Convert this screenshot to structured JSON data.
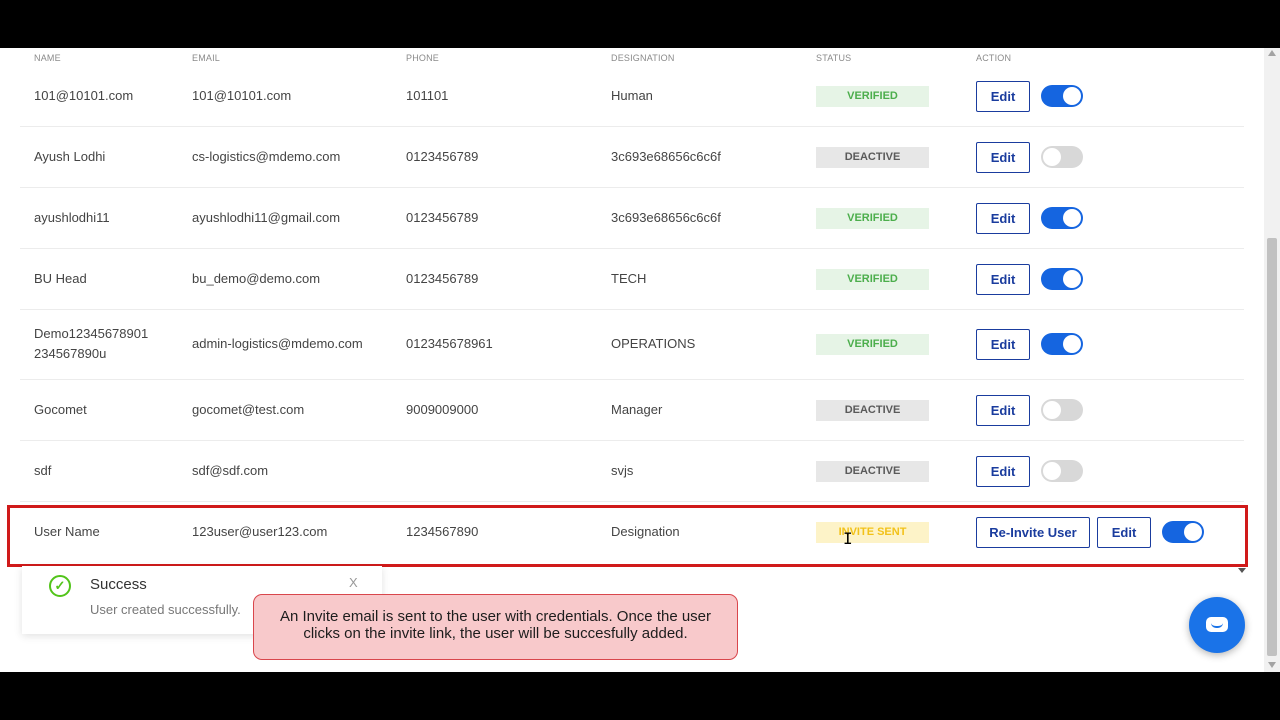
{
  "table": {
    "headers": {
      "name": "NAME",
      "email": "EMAIL",
      "phone": "PHONE",
      "designation": "DESIGNATION",
      "status": "STATUS",
      "action": "ACTION"
    },
    "rows": [
      {
        "name": "101@10101.com",
        "email": "101@10101.com",
        "phone": "101101",
        "designation": "Human",
        "status": "VERIFIED",
        "status_type": "verified",
        "edit": "Edit",
        "toggle": "on"
      },
      {
        "name": "Ayush Lodhi",
        "email": "cs-logistics@mdemo.com",
        "phone": "0123456789",
        "designation": "3c693e68656c6c6f",
        "status": "DEACTIVE",
        "status_type": "deactive",
        "edit": "Edit",
        "toggle": "off"
      },
      {
        "name": "ayushlodhi11",
        "email": "ayushlodhi11@gmail.com",
        "phone": "0123456789",
        "designation": "3c693e68656c6c6f",
        "status": "VERIFIED",
        "status_type": "verified",
        "edit": "Edit",
        "toggle": "on"
      },
      {
        "name": "BU Head",
        "email": "bu_demo@demo.com",
        "phone": "0123456789",
        "designation": "TECH",
        "status": "VERIFIED",
        "status_type": "verified",
        "edit": "Edit",
        "toggle": "on"
      },
      {
        "name": "Demo12345678901 234567890u",
        "email": "admin-logistics@mdemo.com",
        "phone": "012345678961",
        "designation": "OPERATIONS",
        "status": "VERIFIED",
        "status_type": "verified",
        "edit": "Edit",
        "toggle": "on"
      },
      {
        "name": "Gocomet",
        "email": "gocomet@test.com",
        "phone": "9009009000",
        "designation": "Manager",
        "status": "DEACTIVE",
        "status_type": "deactive",
        "edit": "Edit",
        "toggle": "off"
      },
      {
        "name": "sdf",
        "email": "sdf@sdf.com",
        "phone": "",
        "designation": "svjs",
        "status": "DEACTIVE",
        "status_type": "deactive",
        "edit": "Edit",
        "toggle": "off"
      },
      {
        "name": "User Name",
        "email": "123user@user123.com",
        "phone": "1234567890",
        "designation": "Designation",
        "status": "INVITE SENT",
        "status_type": "invite",
        "reinvite": "Re-Invite User",
        "edit": "Edit",
        "toggle": "on"
      }
    ]
  },
  "toast": {
    "title": "Success",
    "message": "User created successfully.",
    "close": "X"
  },
  "callout": {
    "text": "An Invite email is sent to the user with credentials. Once the user clicks on the invite link, the user will be succesfully added."
  },
  "colors": {
    "accent": "#1565e0",
    "highlight": "#d01a1a",
    "verified": "#4cae4c",
    "invite": "#f2c21a"
  },
  "icons": {
    "toast": "check-circle-icon",
    "chat": "chat-bubble-icon",
    "cursor": "text-cursor-icon"
  }
}
